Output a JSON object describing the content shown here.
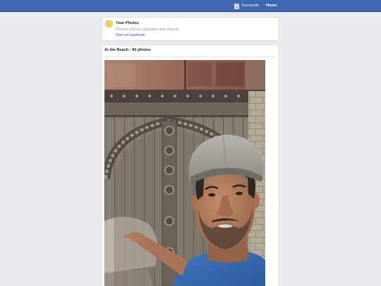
{
  "colors": {
    "top_bar": "#4267b2",
    "page_background": "#e9ebee",
    "card_background": "#ffffff",
    "link": "#365899",
    "muted_text": "#90949c",
    "heading_text": "#1d2129",
    "photos_icon": "#f5cd5a"
  },
  "top_bar": {
    "profile": {
      "avatar_icon": "broken-image-icon",
      "name": "Fernando"
    },
    "home_label": "Home"
  },
  "your_photos": {
    "icon": "photos-icon",
    "title": "Your Photos",
    "subtitle": "Photos you've uploaded and shared",
    "link_label": "View on Facebook"
  },
  "album": {
    "title": "At the Beach - 90 photos"
  }
}
